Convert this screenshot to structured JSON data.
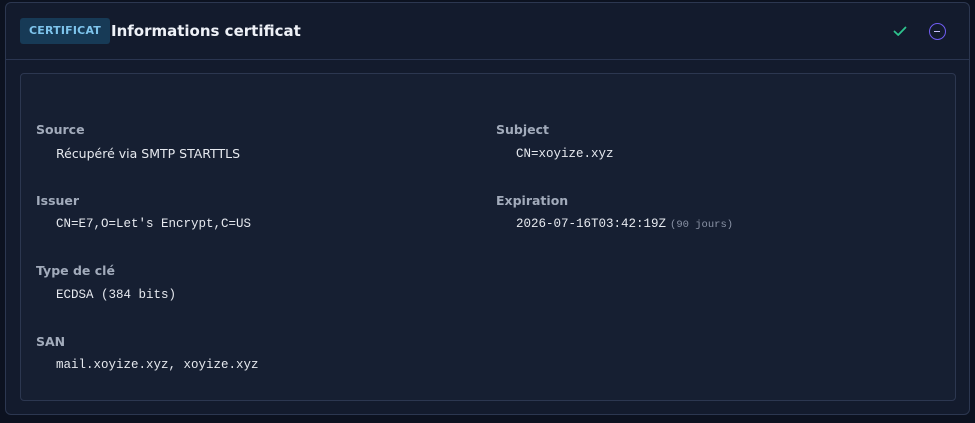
{
  "header": {
    "badge": "CERTIFICAT",
    "title": "Informations certificat",
    "icons": {
      "status": "check-icon",
      "collapse": "minus-circle-icon"
    },
    "colors": {
      "status_ok": "#2ec48e",
      "collapse_accent": "#6f5cf2",
      "badge_text": "#7ec4ec",
      "badge_bg": "#173a56"
    }
  },
  "fields": {
    "source": {
      "label": "Source",
      "value": "Récupéré via SMTP STARTTLS"
    },
    "subject": {
      "label": "Subject",
      "value": "CN=xoyize.xyz"
    },
    "issuer": {
      "label": "Issuer",
      "value": "CN=E7,O=Let's Encrypt,C=US"
    },
    "expiration": {
      "label": "Expiration",
      "value": "2026-07-16T03:42:19Z",
      "note": "(90 jours)"
    },
    "key_type": {
      "label": "Type de clé",
      "value": "ECDSA (384 bits)"
    },
    "san": {
      "label": "SAN",
      "value": "mail.xoyize.xyz, xoyize.xyz"
    }
  }
}
